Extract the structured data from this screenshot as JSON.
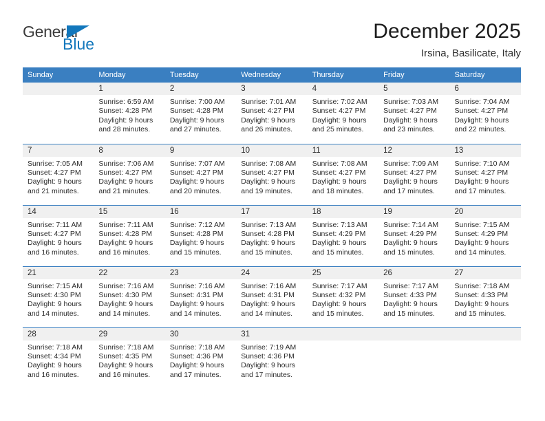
{
  "brand": {
    "name_part1": "General",
    "name_part2": "Blue",
    "accent_color": "#1277bc"
  },
  "header": {
    "title": "December 2025",
    "subtitle": "Irsina, Basilicate, Italy"
  },
  "theme": {
    "header_row_color": "#3a7fc1",
    "daynum_band_color": "#f0f0f0",
    "text_color": "#2b2b2b"
  },
  "weekday_headers": [
    "Sunday",
    "Monday",
    "Tuesday",
    "Wednesday",
    "Thursday",
    "Friday",
    "Saturday"
  ],
  "weeks": [
    [
      {
        "day": "",
        "empty": true,
        "sunrise": "",
        "sunset": "",
        "daylight_line1": "",
        "daylight_line2": ""
      },
      {
        "day": "1",
        "sunrise": "Sunrise: 6:59 AM",
        "sunset": "Sunset: 4:28 PM",
        "daylight_line1": "Daylight: 9 hours",
        "daylight_line2": "and 28 minutes."
      },
      {
        "day": "2",
        "sunrise": "Sunrise: 7:00 AM",
        "sunset": "Sunset: 4:28 PM",
        "daylight_line1": "Daylight: 9 hours",
        "daylight_line2": "and 27 minutes."
      },
      {
        "day": "3",
        "sunrise": "Sunrise: 7:01 AM",
        "sunset": "Sunset: 4:27 PM",
        "daylight_line1": "Daylight: 9 hours",
        "daylight_line2": "and 26 minutes."
      },
      {
        "day": "4",
        "sunrise": "Sunrise: 7:02 AM",
        "sunset": "Sunset: 4:27 PM",
        "daylight_line1": "Daylight: 9 hours",
        "daylight_line2": "and 25 minutes."
      },
      {
        "day": "5",
        "sunrise": "Sunrise: 7:03 AM",
        "sunset": "Sunset: 4:27 PM",
        "daylight_line1": "Daylight: 9 hours",
        "daylight_line2": "and 23 minutes."
      },
      {
        "day": "6",
        "sunrise": "Sunrise: 7:04 AM",
        "sunset": "Sunset: 4:27 PM",
        "daylight_line1": "Daylight: 9 hours",
        "daylight_line2": "and 22 minutes."
      }
    ],
    [
      {
        "day": "7",
        "sunrise": "Sunrise: 7:05 AM",
        "sunset": "Sunset: 4:27 PM",
        "daylight_line1": "Daylight: 9 hours",
        "daylight_line2": "and 21 minutes."
      },
      {
        "day": "8",
        "sunrise": "Sunrise: 7:06 AM",
        "sunset": "Sunset: 4:27 PM",
        "daylight_line1": "Daylight: 9 hours",
        "daylight_line2": "and 21 minutes."
      },
      {
        "day": "9",
        "sunrise": "Sunrise: 7:07 AM",
        "sunset": "Sunset: 4:27 PM",
        "daylight_line1": "Daylight: 9 hours",
        "daylight_line2": "and 20 minutes."
      },
      {
        "day": "10",
        "sunrise": "Sunrise: 7:08 AM",
        "sunset": "Sunset: 4:27 PM",
        "daylight_line1": "Daylight: 9 hours",
        "daylight_line2": "and 19 minutes."
      },
      {
        "day": "11",
        "sunrise": "Sunrise: 7:08 AM",
        "sunset": "Sunset: 4:27 PM",
        "daylight_line1": "Daylight: 9 hours",
        "daylight_line2": "and 18 minutes."
      },
      {
        "day": "12",
        "sunrise": "Sunrise: 7:09 AM",
        "sunset": "Sunset: 4:27 PM",
        "daylight_line1": "Daylight: 9 hours",
        "daylight_line2": "and 17 minutes."
      },
      {
        "day": "13",
        "sunrise": "Sunrise: 7:10 AM",
        "sunset": "Sunset: 4:27 PM",
        "daylight_line1": "Daylight: 9 hours",
        "daylight_line2": "and 17 minutes."
      }
    ],
    [
      {
        "day": "14",
        "sunrise": "Sunrise: 7:11 AM",
        "sunset": "Sunset: 4:27 PM",
        "daylight_line1": "Daylight: 9 hours",
        "daylight_line2": "and 16 minutes."
      },
      {
        "day": "15",
        "sunrise": "Sunrise: 7:11 AM",
        "sunset": "Sunset: 4:28 PM",
        "daylight_line1": "Daylight: 9 hours",
        "daylight_line2": "and 16 minutes."
      },
      {
        "day": "16",
        "sunrise": "Sunrise: 7:12 AM",
        "sunset": "Sunset: 4:28 PM",
        "daylight_line1": "Daylight: 9 hours",
        "daylight_line2": "and 15 minutes."
      },
      {
        "day": "17",
        "sunrise": "Sunrise: 7:13 AM",
        "sunset": "Sunset: 4:28 PM",
        "daylight_line1": "Daylight: 9 hours",
        "daylight_line2": "and 15 minutes."
      },
      {
        "day": "18",
        "sunrise": "Sunrise: 7:13 AM",
        "sunset": "Sunset: 4:29 PM",
        "daylight_line1": "Daylight: 9 hours",
        "daylight_line2": "and 15 minutes."
      },
      {
        "day": "19",
        "sunrise": "Sunrise: 7:14 AM",
        "sunset": "Sunset: 4:29 PM",
        "daylight_line1": "Daylight: 9 hours",
        "daylight_line2": "and 15 minutes."
      },
      {
        "day": "20",
        "sunrise": "Sunrise: 7:15 AM",
        "sunset": "Sunset: 4:29 PM",
        "daylight_line1": "Daylight: 9 hours",
        "daylight_line2": "and 14 minutes."
      }
    ],
    [
      {
        "day": "21",
        "sunrise": "Sunrise: 7:15 AM",
        "sunset": "Sunset: 4:30 PM",
        "daylight_line1": "Daylight: 9 hours",
        "daylight_line2": "and 14 minutes."
      },
      {
        "day": "22",
        "sunrise": "Sunrise: 7:16 AM",
        "sunset": "Sunset: 4:30 PM",
        "daylight_line1": "Daylight: 9 hours",
        "daylight_line2": "and 14 minutes."
      },
      {
        "day": "23",
        "sunrise": "Sunrise: 7:16 AM",
        "sunset": "Sunset: 4:31 PM",
        "daylight_line1": "Daylight: 9 hours",
        "daylight_line2": "and 14 minutes."
      },
      {
        "day": "24",
        "sunrise": "Sunrise: 7:16 AM",
        "sunset": "Sunset: 4:31 PM",
        "daylight_line1": "Daylight: 9 hours",
        "daylight_line2": "and 14 minutes."
      },
      {
        "day": "25",
        "sunrise": "Sunrise: 7:17 AM",
        "sunset": "Sunset: 4:32 PM",
        "daylight_line1": "Daylight: 9 hours",
        "daylight_line2": "and 15 minutes."
      },
      {
        "day": "26",
        "sunrise": "Sunrise: 7:17 AM",
        "sunset": "Sunset: 4:33 PM",
        "daylight_line1": "Daylight: 9 hours",
        "daylight_line2": "and 15 minutes."
      },
      {
        "day": "27",
        "sunrise": "Sunrise: 7:18 AM",
        "sunset": "Sunset: 4:33 PM",
        "daylight_line1": "Daylight: 9 hours",
        "daylight_line2": "and 15 minutes."
      }
    ],
    [
      {
        "day": "28",
        "sunrise": "Sunrise: 7:18 AM",
        "sunset": "Sunset: 4:34 PM",
        "daylight_line1": "Daylight: 9 hours",
        "daylight_line2": "and 16 minutes."
      },
      {
        "day": "29",
        "sunrise": "Sunrise: 7:18 AM",
        "sunset": "Sunset: 4:35 PM",
        "daylight_line1": "Daylight: 9 hours",
        "daylight_line2": "and 16 minutes."
      },
      {
        "day": "30",
        "sunrise": "Sunrise: 7:18 AM",
        "sunset": "Sunset: 4:36 PM",
        "daylight_line1": "Daylight: 9 hours",
        "daylight_line2": "and 17 minutes."
      },
      {
        "day": "31",
        "sunrise": "Sunrise: 7:19 AM",
        "sunset": "Sunset: 4:36 PM",
        "daylight_line1": "Daylight: 9 hours",
        "daylight_line2": "and 17 minutes."
      },
      {
        "day": "",
        "empty": true,
        "sunrise": "",
        "sunset": "",
        "daylight_line1": "",
        "daylight_line2": ""
      },
      {
        "day": "",
        "empty": true,
        "sunrise": "",
        "sunset": "",
        "daylight_line1": "",
        "daylight_line2": ""
      },
      {
        "day": "",
        "empty": true,
        "sunrise": "",
        "sunset": "",
        "daylight_line1": "",
        "daylight_line2": ""
      }
    ]
  ]
}
